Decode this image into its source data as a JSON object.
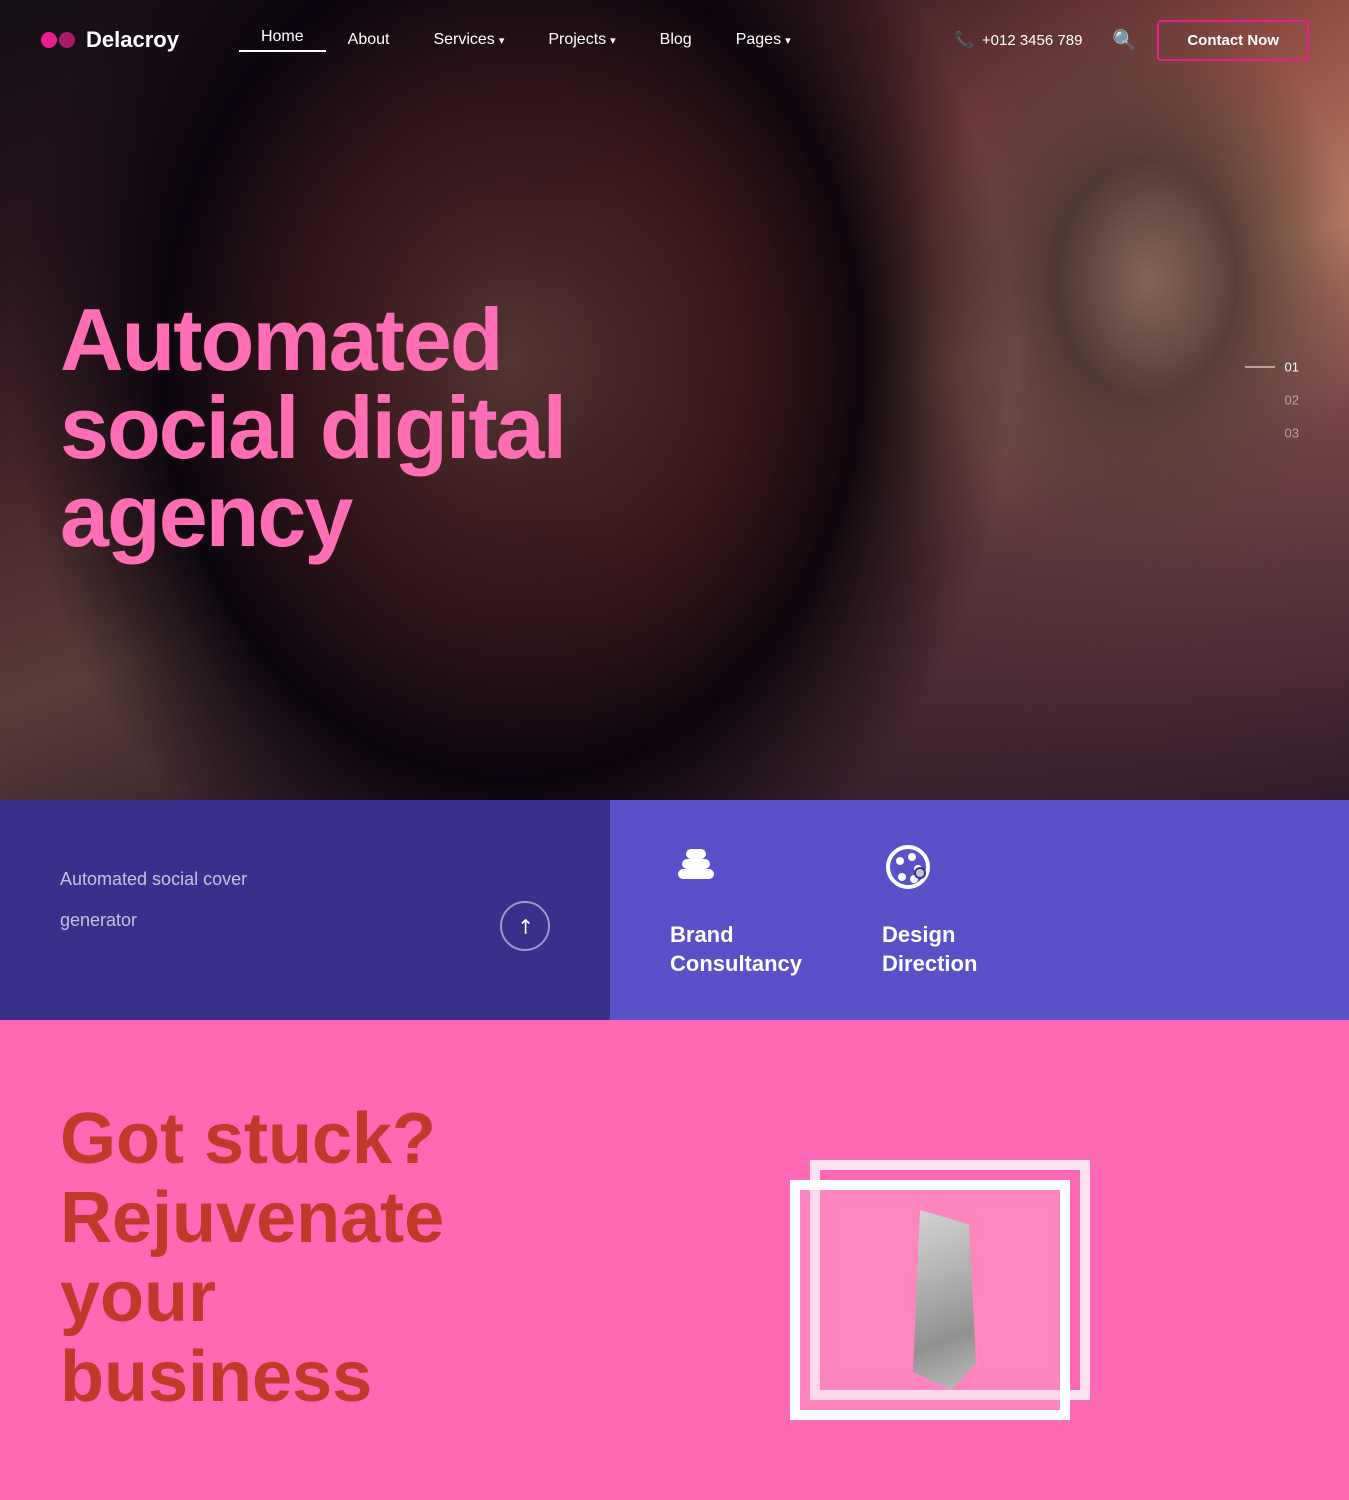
{
  "brand": {
    "name": "Delacroy",
    "logo_alt": "Delacroy logo"
  },
  "nav": {
    "links": [
      {
        "label": "Home",
        "active": true,
        "has_dropdown": false
      },
      {
        "label": "About",
        "active": false,
        "has_dropdown": false
      },
      {
        "label": "Services",
        "active": false,
        "has_dropdown": true
      },
      {
        "label": "Projects",
        "active": false,
        "has_dropdown": true
      },
      {
        "label": "Blog",
        "active": false,
        "has_dropdown": false
      },
      {
        "label": "Pages",
        "active": false,
        "has_dropdown": true
      }
    ],
    "phone": "+012 3456 789",
    "contact_label": "Contact Now"
  },
  "hero": {
    "heading_line1": "Automated",
    "heading_line2": "social digital",
    "heading_line3": "agency",
    "slides": [
      "01",
      "02",
      "03"
    ]
  },
  "bottom_band": {
    "subtitle": "Automated social cover",
    "subtitle2": "generator",
    "services": [
      {
        "id": "brand",
        "name": "Brand\nConsultancy",
        "icon_label": "brand-icon"
      },
      {
        "id": "design",
        "name": "Design\nDirection",
        "icon_label": "palette-icon"
      }
    ]
  },
  "pink_section": {
    "heading_line1": "Got stuck?",
    "heading_line2": "Rejuvenate",
    "heading_line3": "your business"
  }
}
